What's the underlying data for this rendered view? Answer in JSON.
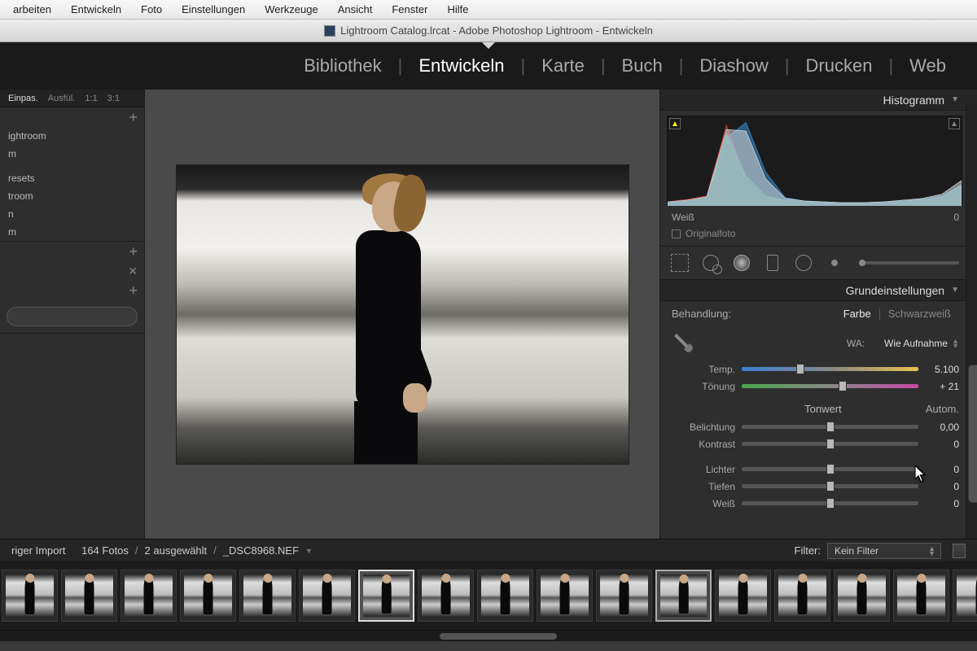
{
  "os_menu": [
    "arbeiten",
    "Entwickeln",
    "Foto",
    "Einstellungen",
    "Werkzeuge",
    "Ansicht",
    "Fenster",
    "Hilfe"
  ],
  "window_title": "Lightroom Catalog.lrcat - Adobe Photoshop Lightroom - Entwickeln",
  "modules": [
    "Bibliothek",
    "Entwickeln",
    "Karte",
    "Buch",
    "Diashow",
    "Drucken",
    "Web"
  ],
  "active_module": "Entwickeln",
  "zoom": {
    "fit": "Einpas.",
    "fill": "Ausfül.",
    "one": "1:1",
    "ratio": "3:1"
  },
  "left_items": [
    "ightroom",
    "m",
    "",
    "resets",
    "troom",
    "n",
    "m"
  ],
  "histogram": {
    "title": "Histogramm",
    "channel_label": "Weiß",
    "channel_value": "0",
    "original": "Originalfoto"
  },
  "basic": {
    "title": "Grundeinstellungen",
    "treatment_label": "Behandlung:",
    "color": "Farbe",
    "bw": "Schwarzweiß",
    "wb_label": "WA:",
    "wb_value": "Wie Aufnahme",
    "temp_label": "Temp.",
    "temp_value": "5.100",
    "temp_pos": 33,
    "tint_label": "Tönung",
    "tint_value": "+ 21",
    "tint_pos": 57,
    "tone_title": "Tonwert",
    "auto": "Autom.",
    "sliders": [
      {
        "label": "Belichtung",
        "value": "0,00",
        "pos": 50
      },
      {
        "label": "Kontrast",
        "value": "0",
        "pos": 50
      },
      {
        "label": "Lichter",
        "value": "0",
        "pos": 50
      },
      {
        "label": "Tiefen",
        "value": "0",
        "pos": 50
      },
      {
        "label": "Weiß",
        "value": "0",
        "pos": 50
      }
    ]
  },
  "status": {
    "import": "riger Import",
    "count": "164 Fotos",
    "selected": "2 ausgewählt",
    "filename": "_DSC8968.NEF",
    "filter_label": "Filter:",
    "filter_value": "Kein Filter"
  },
  "chart_data": {
    "type": "area",
    "title": "Histogramm",
    "xlabel": "",
    "ylabel": "",
    "xlim": [
      0,
      255
    ],
    "ylim": [
      0,
      1
    ],
    "series": [
      {
        "name": "R",
        "color": "#d43a3a",
        "values": [
          0.05,
          0.08,
          0.12,
          0.95,
          0.3,
          0.1,
          0.06,
          0.05,
          0.04,
          0.04,
          0.04,
          0.05,
          0.06,
          0.08,
          0.12,
          0.25
        ]
      },
      {
        "name": "G",
        "color": "#3ad47a",
        "values": [
          0.04,
          0.06,
          0.1,
          0.85,
          0.35,
          0.12,
          0.07,
          0.05,
          0.04,
          0.04,
          0.04,
          0.05,
          0.06,
          0.08,
          0.12,
          0.25
        ]
      },
      {
        "name": "B",
        "color": "#3a8fd4",
        "values": [
          0.04,
          0.06,
          0.09,
          0.8,
          0.98,
          0.4,
          0.1,
          0.06,
          0.05,
          0.04,
          0.04,
          0.05,
          0.06,
          0.08,
          0.12,
          0.25
        ]
      },
      {
        "name": "L",
        "color": "#d8d8d8",
        "values": [
          0.05,
          0.07,
          0.11,
          0.9,
          0.88,
          0.32,
          0.09,
          0.06,
          0.05,
          0.04,
          0.04,
          0.05,
          0.07,
          0.09,
          0.14,
          0.3
        ]
      }
    ]
  }
}
